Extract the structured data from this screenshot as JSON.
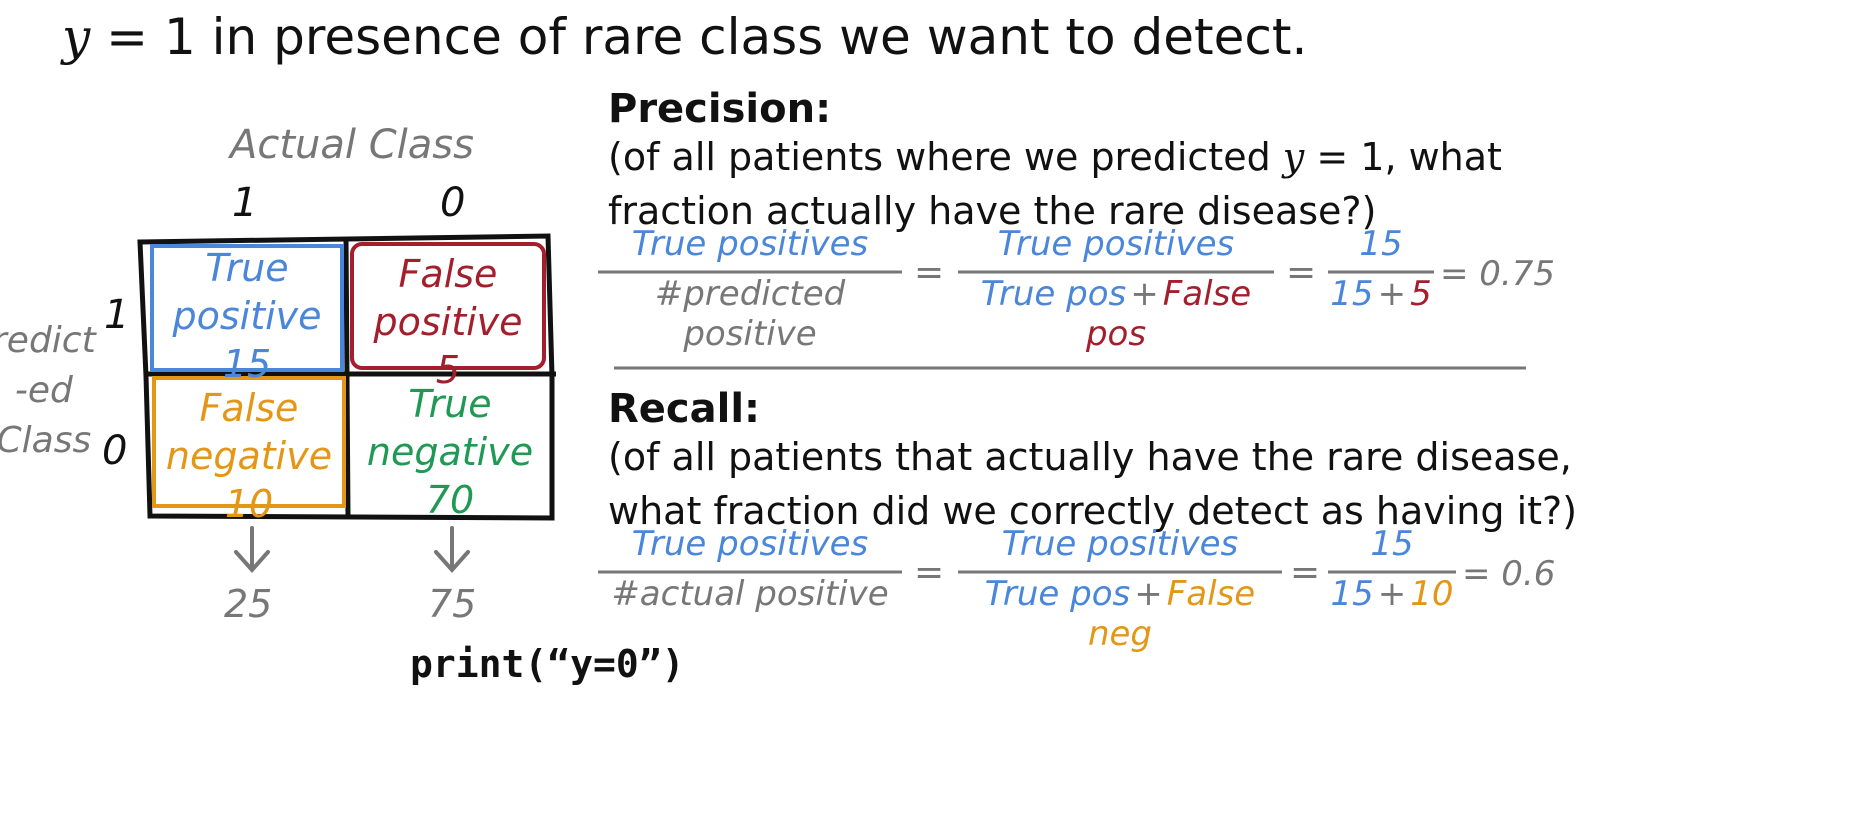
{
  "header": {
    "var": "y",
    "eq": "= 1",
    "text": " in presence of rare class we want to detect."
  },
  "matrix": {
    "actual_label": "Actual Class",
    "actual_cols": [
      "1",
      "0"
    ],
    "pred_label_lines": [
      "redict",
      "-ed",
      "Class"
    ],
    "pred_rows": [
      "1",
      "0"
    ],
    "cells": {
      "tp": {
        "l1": "True",
        "l2": "positive",
        "v": "15"
      },
      "fp": {
        "l1": "False",
        "l2": "positive",
        "v": "5"
      },
      "fn": {
        "l1": "False",
        "l2": "negative",
        "v": "10"
      },
      "tn": {
        "l1": "True",
        "l2": "negative",
        "v": "70"
      }
    },
    "col_totals": [
      "25",
      "75"
    ]
  },
  "precision": {
    "title": "Precision:",
    "desc1_a": "(of all patients where we predicted ",
    "desc1_var": "y",
    "desc1_eq": " = 1",
    "desc1_b": ", what",
    "desc2": "fraction actually have the rare disease?)",
    "f1_num": "True positives",
    "f1_den": "#predicted positive",
    "f2_num": "True positives",
    "f2_den_a": "True pos",
    "f2_den_plus": "+",
    "f2_den_b": "False pos",
    "f3_num": "15",
    "f3_den_a": "15",
    "f3_den_plus": "+",
    "f3_den_b": "5",
    "eq": "=",
    "result": "= 0.75"
  },
  "recall": {
    "title": "Recall:",
    "desc1": "(of all patients that actually have the rare disease,",
    "desc2": "what fraction did we correctly detect as having it?)",
    "f1_num": "True positives",
    "f1_den": "#actual positive",
    "f2_num": "True positives",
    "f2_den_a": "True pos",
    "f2_den_plus": "+",
    "f2_den_b": "False neg",
    "f3_num": "15",
    "f3_den_a": "15",
    "f3_den_plus": "+",
    "f3_den_b": "10",
    "eq": "=",
    "result": "= 0.6"
  },
  "code": {
    "text": "print(“y=0”)"
  },
  "colors": {
    "true_positive": "#4a86d9",
    "false_positive": "#a31f2c",
    "false_negative": "#e49717",
    "true_negative": "#1f9a54",
    "muted": "#777777"
  }
}
